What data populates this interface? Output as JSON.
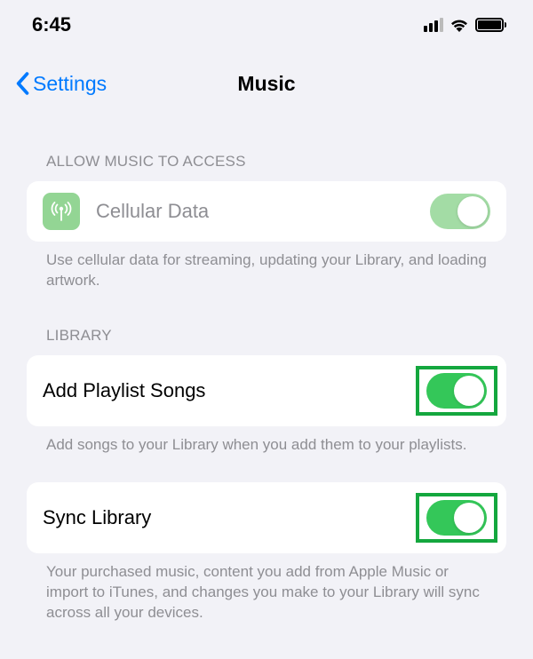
{
  "status": {
    "time": "6:45"
  },
  "nav": {
    "back_label": "Settings",
    "title": "Music"
  },
  "sections": {
    "access": {
      "header": "ALLOW MUSIC TO ACCESS",
      "cellular": {
        "label": "Cellular Data",
        "footer": "Use cellular data for streaming, updating your Library, and loading artwork."
      }
    },
    "library": {
      "header": "LIBRARY",
      "add_playlist": {
        "label": "Add Playlist Songs",
        "footer": "Add songs to your Library when you add them to your playlists."
      },
      "sync": {
        "label": "Sync Library",
        "footer": "Your purchased music, content you add from Apple Music or import to iTunes, and changes you make to your Library will sync across all your devices."
      }
    }
  }
}
